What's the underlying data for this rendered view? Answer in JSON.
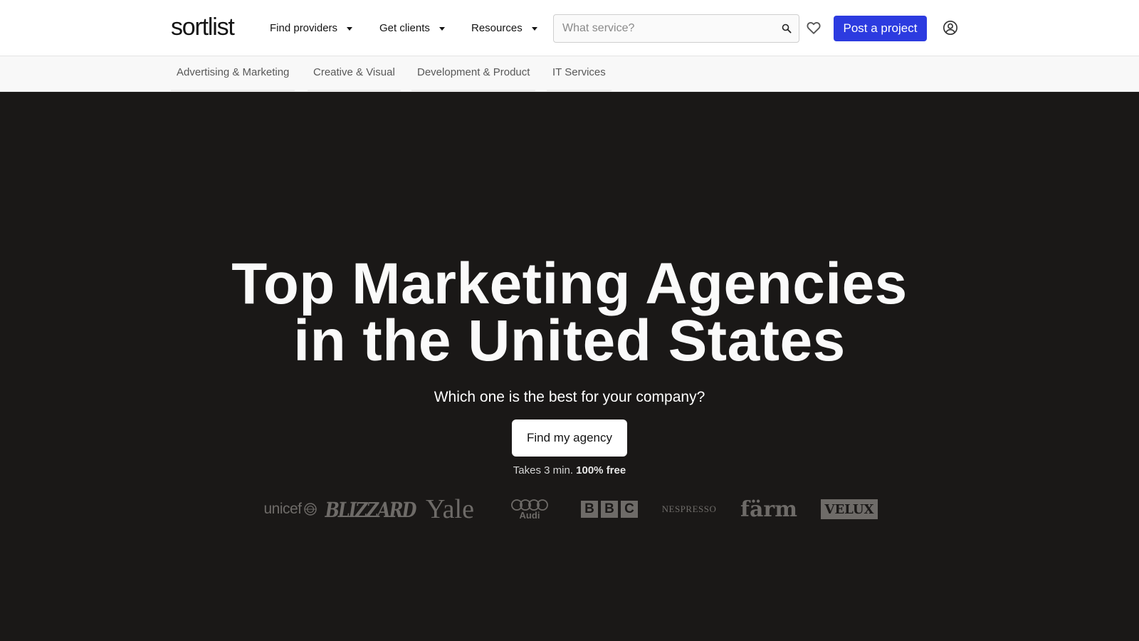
{
  "header": {
    "logo": "sortlist",
    "nav": [
      {
        "label": "Find providers"
      },
      {
        "label": "Get clients"
      },
      {
        "label": "Resources"
      }
    ],
    "search": {
      "placeholder": "What service?",
      "value": ""
    },
    "post_label": "Post a project"
  },
  "categories": [
    {
      "label": "Advertising & Marketing"
    },
    {
      "label": "Creative & Visual"
    },
    {
      "label": "Development & Product"
    },
    {
      "label": "IT Services"
    }
  ],
  "hero": {
    "title_line1": "Top Marketing Agencies",
    "title_line2": "in the United States",
    "subtitle": "Which one is the best for your company?",
    "cta_label": "Find my agency",
    "takes_text": "Takes 3 min.",
    "free_text": "100% free"
  },
  "client_logos": {
    "unicef": "unicef",
    "blizzard": "BLIZZARD",
    "yale": "Yale",
    "audi": "Audi",
    "bbc": [
      "B",
      "B",
      "C"
    ],
    "nespresso": "NESPRESSO",
    "farm": "färm",
    "velux": "VELUX"
  },
  "colors": {
    "primary_button": "#2c3be0",
    "hero_background": "#1a1817",
    "logo_gray": "#6e6b68"
  },
  "icons": [
    "chevron-down-icon",
    "search-icon",
    "heart-icon",
    "user-icon"
  ]
}
